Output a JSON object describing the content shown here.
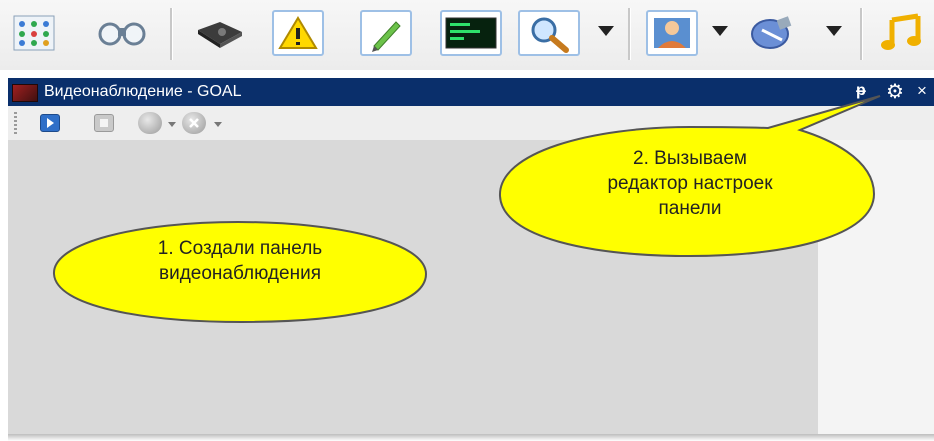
{
  "window": {
    "title": "Видеонаблюдение - GOAL",
    "pin_glyph": "ᵽ",
    "gear_glyph": "⚙",
    "close_glyph": "×"
  },
  "toolbar": {
    "icons": [
      "network-map-icon",
      "binoculars-icon",
      "hard-drive-icon",
      "warning-icon",
      "edit-pencil-icon",
      "terminal-icon",
      "search-magnifier-icon",
      "user-icon",
      "satellite-icon",
      "music-icon"
    ]
  },
  "panel_toolbar": {
    "icons": [
      "play-icon",
      "stop-icon",
      "record-icon",
      "cancel-icon"
    ]
  },
  "callouts": {
    "first": {
      "line1": "1. Создали панель",
      "line2": "видеонаблюдения"
    },
    "second": {
      "line1": "2. Вызываем",
      "line2": "редактор настроек",
      "line3": "панели"
    }
  },
  "colors": {
    "titlebar": "#0a2f6b",
    "callout_fill": "#ffff00",
    "content_bg": "#d9d9d9"
  }
}
